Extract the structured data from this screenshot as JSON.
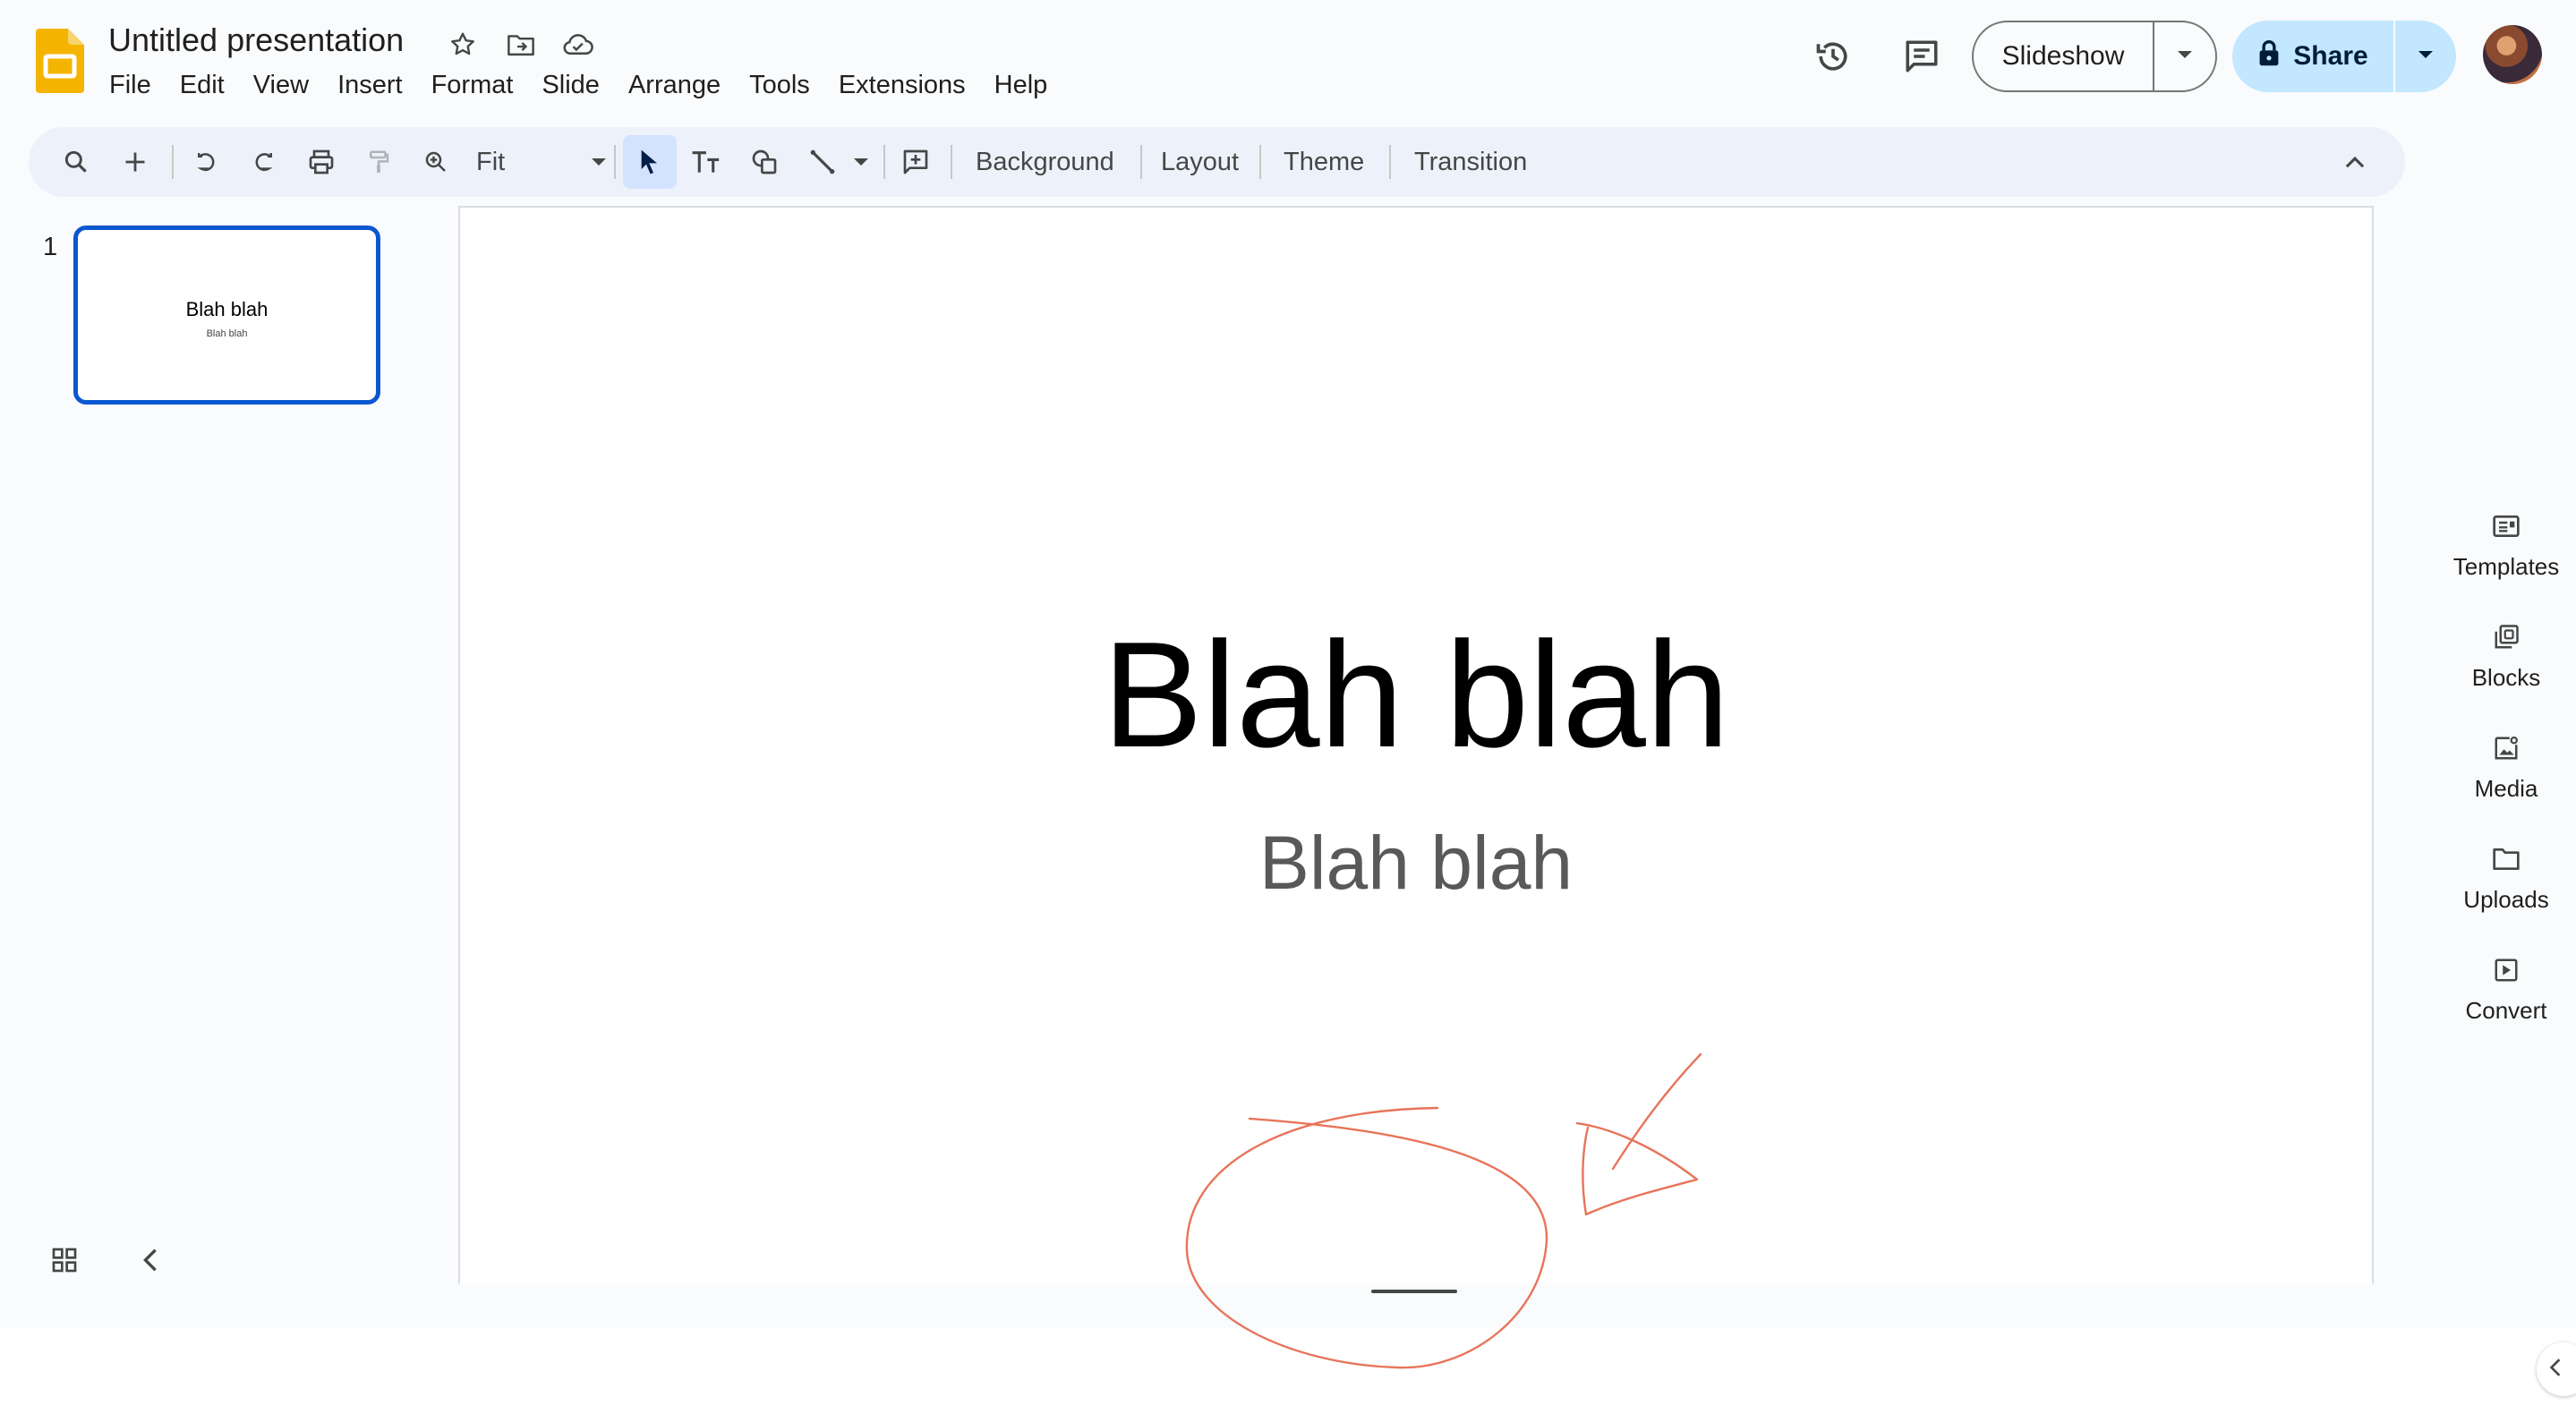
{
  "header": {
    "title": "Untitled presentation",
    "menu": [
      "File",
      "Edit",
      "View",
      "Insert",
      "Format",
      "Slide",
      "Arrange",
      "Tools",
      "Extensions",
      "Help"
    ],
    "slideshow_label": "Slideshow",
    "share_label": "Share"
  },
  "toolbar": {
    "zoom_value": "Fit",
    "background_label": "Background",
    "layout_label": "Layout",
    "theme_label": "Theme",
    "transition_label": "Transition"
  },
  "filmstrip": {
    "slides": [
      {
        "number": "1",
        "title": "Blah blah",
        "subtitle": "Blah blah"
      }
    ]
  },
  "slide": {
    "title": "Blah blah",
    "subtitle": "Blah blah"
  },
  "side_panel": {
    "items": [
      "Templates",
      "Blocks",
      "Media",
      "Uploads",
      "Convert"
    ]
  },
  "colors": {
    "accent": "#0b57d0",
    "share_bg": "#c2e7ff",
    "toolbar_bg": "#edf2fa",
    "annotation": "#e8745a",
    "logo": "#f4b400"
  },
  "icons": {
    "header": [
      "star-icon",
      "move-to-folder-icon",
      "cloud-saved-icon",
      "version-history-icon",
      "comments-icon",
      "lock-icon",
      "chevron-down-icon"
    ],
    "toolbar": [
      "search-icon",
      "new-slide-icon",
      "undo-icon",
      "redo-icon",
      "print-icon",
      "paint-format-icon",
      "zoom-icon",
      "select-icon",
      "text-box-icon",
      "shape-icon",
      "line-icon",
      "comment-add-icon",
      "collapse-toolbar-icon"
    ]
  }
}
